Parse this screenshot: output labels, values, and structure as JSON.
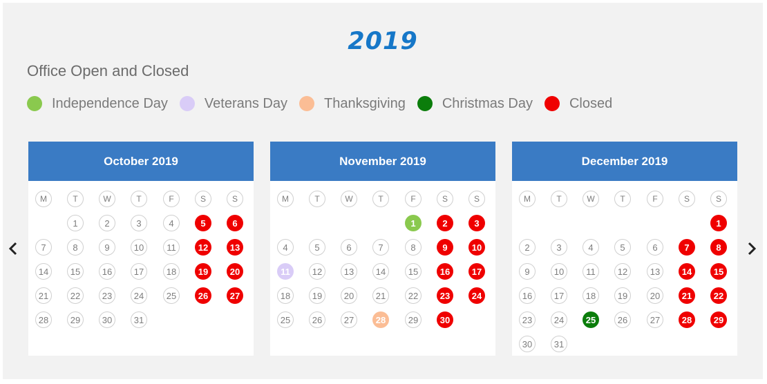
{
  "year": "2019",
  "subtitle": "Office Open and Closed",
  "legend": [
    {
      "label": "Independence Day",
      "color": "#8ac94e"
    },
    {
      "label": "Veterans Day",
      "color": "#d9ccf7"
    },
    {
      "label": "Thanksgiving",
      "color": "#fbbd95"
    },
    {
      "label": "Christmas Day",
      "color": "#0b7d0b"
    },
    {
      "label": "Closed",
      "color": "#ef0000"
    }
  ],
  "weekdays": [
    "M",
    "T",
    "W",
    "T",
    "F",
    "S",
    "S"
  ],
  "months": [
    {
      "title": "October 2019",
      "first_weekday": 2,
      "days": 31,
      "marked": {
        "5": "Closed",
        "6": "Closed",
        "12": "Closed",
        "13": "Closed",
        "19": "Closed",
        "20": "Closed",
        "26": "Closed",
        "27": "Closed"
      }
    },
    {
      "title": "November 2019",
      "first_weekday": 5,
      "days": 30,
      "marked": {
        "1": "Independence Day",
        "2": "Closed",
        "3": "Closed",
        "9": "Closed",
        "10": "Closed",
        "11": "Veterans Day",
        "16": "Closed",
        "17": "Closed",
        "23": "Closed",
        "24": "Closed",
        "28": "Thanksgiving",
        "30": "Closed"
      }
    },
    {
      "title": "December 2019",
      "first_weekday": 7,
      "days": 31,
      "marked": {
        "1": "Closed",
        "7": "Closed",
        "8": "Closed",
        "14": "Closed",
        "15": "Closed",
        "21": "Closed",
        "22": "Closed",
        "25": "Christmas Day",
        "28": "Closed",
        "29": "Closed"
      }
    }
  ],
  "nav": {
    "prev_icon": "chevron-left-icon",
    "next_icon": "chevron-right-icon"
  }
}
